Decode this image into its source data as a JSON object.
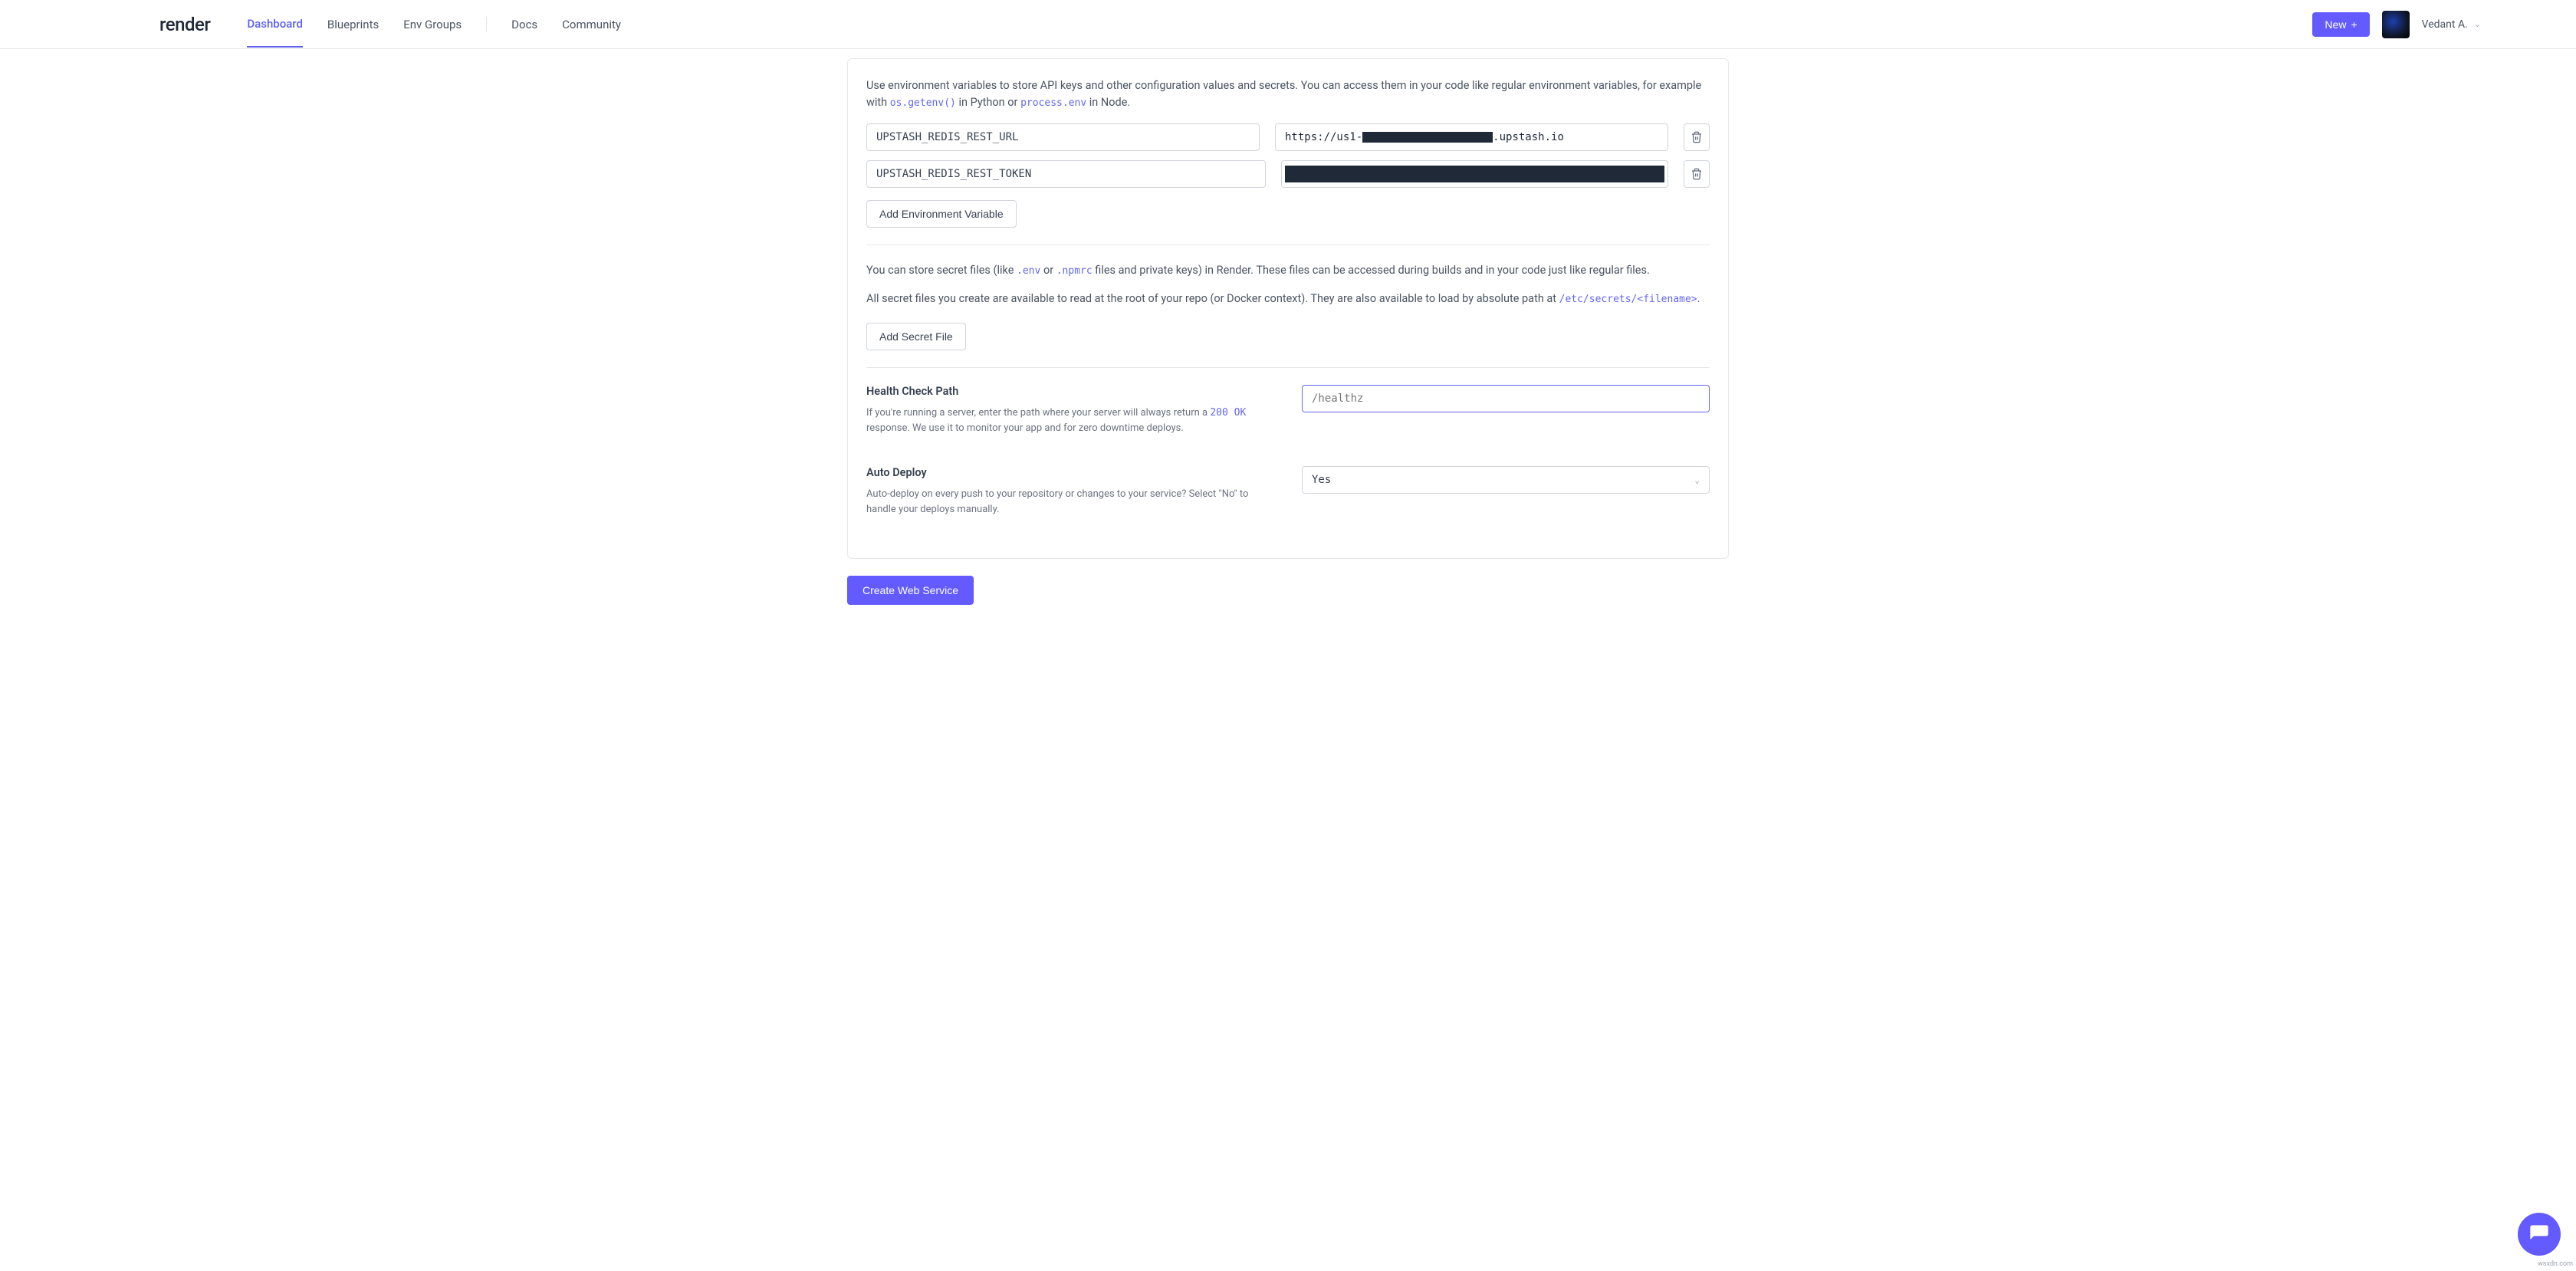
{
  "brand": "render",
  "nav": {
    "dashboard": "Dashboard",
    "blueprints": "Blueprints",
    "envgroups": "Env Groups",
    "docs": "Docs",
    "community": "Community"
  },
  "header": {
    "new_label": "New",
    "user_name": "Vedant A."
  },
  "env_section": {
    "intro_part1": "Use environment variables to store API keys and other configuration values and secrets. You can access them in your code like regular environment variables, for example with ",
    "code1": "os.getenv()",
    "mid1": " in Python or ",
    "code2": "process.env",
    "mid2": " in Node.",
    "vars": [
      {
        "key": "UPSTASH_REDIS_REST_URL",
        "value_prefix": "https://us1-",
        "value_suffix": ".upstash.io",
        "partial_redact": true
      },
      {
        "key": "UPSTASH_REDIS_REST_TOKEN",
        "value_prefix": "",
        "value_suffix": "",
        "partial_redact": false
      }
    ],
    "add_btn": "Add Environment Variable"
  },
  "secret_section": {
    "line1_a": "You can store secret files (like ",
    "code_env": ".env",
    "line1_b": " or ",
    "code_npmrc": ".npmrc",
    "line1_c": " files and private keys) in Render. These files can be accessed during builds and in your code just like regular files.",
    "line2_a": "All secret files you create are available to read at the root of your repo (or Docker context). They are also available to load by absolute path at ",
    "code_path": "/etc/secrets/<filename>",
    "line2_b": ".",
    "add_btn": "Add Secret File"
  },
  "health": {
    "title": "Health Check Path",
    "desc_a": "If you're running a server, enter the path where your server will always return a ",
    "code": "200 OK",
    "desc_b": " response. We use it to monitor your app and for zero downtime deploys.",
    "placeholder": "/healthz"
  },
  "autodeploy": {
    "title": "Auto Deploy",
    "desc": "Auto-deploy on every push to your repository or changes to your service? Select \"No\" to handle your deploys manually.",
    "value": "Yes"
  },
  "submit": "Create Web Service",
  "watermark": "wsxdn.com"
}
